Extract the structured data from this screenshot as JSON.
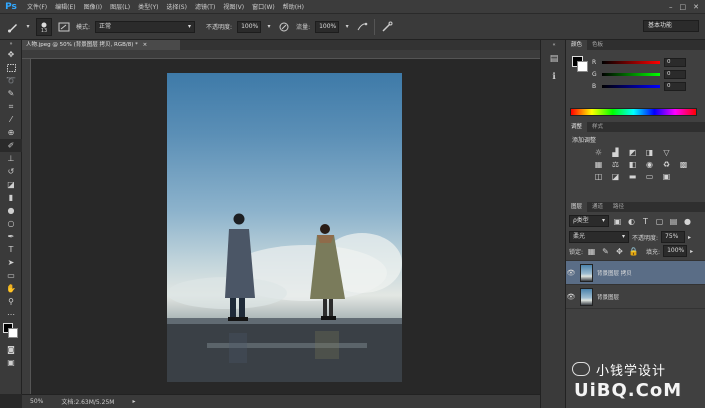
{
  "app": {
    "logo": "Ps"
  },
  "menu": [
    "文件(F)",
    "编辑(E)",
    "图像(I)",
    "图层(L)",
    "类型(Y)",
    "选择(S)",
    "滤镜(T)",
    "视图(V)",
    "窗口(W)",
    "帮助(H)"
  ],
  "window_controls": {
    "minimize": "–",
    "restore": "□",
    "close": "✕"
  },
  "options": {
    "brush_size": "13",
    "mode_label": "模式:",
    "mode_value": "正常",
    "opacity_label": "不透明度:",
    "opacity_value": "100%",
    "flow_label": "流量:",
    "flow_value": "100%",
    "workspace": "基本功能"
  },
  "document": {
    "tab_title": "人物.jpeg @ 50% (背景图层 拷贝, RGB/8) *",
    "close": "×",
    "zoom": "50%",
    "doc_size": "文档:2.63M/5.25M"
  },
  "color_panel": {
    "tabs": [
      "颜色",
      "色板"
    ],
    "channels": [
      {
        "label": "R",
        "value": "0"
      },
      {
        "label": "G",
        "value": "0"
      },
      {
        "label": "B",
        "value": "0"
      }
    ]
  },
  "adjustments_panel": {
    "tabs": [
      "调整",
      "样式"
    ],
    "title": "添加调整"
  },
  "layers_panel": {
    "tabs": [
      "图层",
      "通道",
      "路径"
    ],
    "kind": "ρ类型",
    "blend_mode": "柔光",
    "opacity_label": "不透明度:",
    "opacity_value": "75%",
    "lock_label": "锁定:",
    "fill_label": "填充:",
    "fill_value": "100%",
    "layers": [
      {
        "name": "背景图层 拷贝",
        "selected": true
      },
      {
        "name": "背景图层",
        "selected": false
      }
    ]
  },
  "watermark": {
    "line1": "小钱学设计",
    "line2": "UiBQ.CoM"
  },
  "colors": {
    "accent": "#31a8ff",
    "panel": "#404040",
    "selected_layer": "#5a6d86"
  }
}
